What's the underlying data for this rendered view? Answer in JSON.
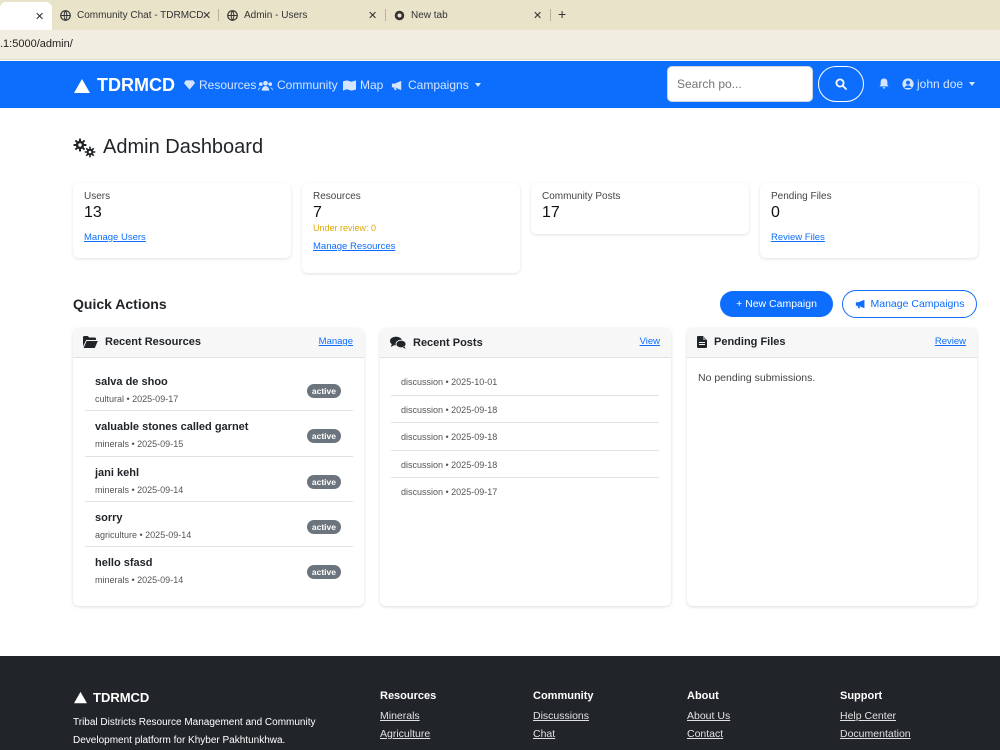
{
  "browser": {
    "tabs": [
      {
        "label": ""
      },
      {
        "label": "Community Chat - TDRMCD"
      },
      {
        "label": "Admin - Users"
      },
      {
        "label": "New tab"
      }
    ],
    "new_tab_symbol": "+",
    "close_symbol": "✕",
    "address": ".1:5000/admin/"
  },
  "navbar": {
    "brand": "TDRMCD",
    "links": [
      {
        "label": "Resources",
        "icon": "gem-icon"
      },
      {
        "label": "Community",
        "icon": "users-icon"
      },
      {
        "label": "Map",
        "icon": "map-icon"
      },
      {
        "label": "Campaigns",
        "icon": "bullhorn-icon"
      }
    ],
    "search_placeholder": "Search po...",
    "user": "john doe",
    "color": "#0d6efd"
  },
  "page": {
    "title": "Admin Dashboard"
  },
  "stats": [
    {
      "label": "Users",
      "value": "13",
      "sub": "",
      "link": "Manage Users"
    },
    {
      "label": "Resources",
      "value": "7",
      "sub": "Under review: 0",
      "link": "Manage Resources"
    },
    {
      "label": "Community Posts",
      "value": "17",
      "sub": "",
      "link": ""
    },
    {
      "label": "Pending Files",
      "value": "0",
      "sub": "",
      "link": "Review Files"
    }
  ],
  "quick_actions": {
    "title": "Quick Actions",
    "new_campaign": "+ New Campaign",
    "manage_campaigns": "Manage Campaigns"
  },
  "panels": {
    "resources": {
      "title": "Recent Resources",
      "link": "Manage",
      "items": [
        {
          "name": "salva de shoo",
          "meta": "cultural • 2025-09-17",
          "status": "active"
        },
        {
          "name": "valuable stones called garnet",
          "meta": "minerals • 2025-09-15",
          "status": "active"
        },
        {
          "name": "jani kehl",
          "meta": "minerals • 2025-09-14",
          "status": "active"
        },
        {
          "name": "sorry",
          "meta": "agriculture • 2025-09-14",
          "status": "active"
        },
        {
          "name": "hello sfasd",
          "meta": "minerals • 2025-09-14",
          "status": "active"
        }
      ]
    },
    "posts": {
      "title": "Recent Posts",
      "link": "View",
      "items": [
        "discussion • 2025-10-01",
        "discussion • 2025-09-18",
        "discussion • 2025-09-18",
        "discussion • 2025-09-18",
        "discussion • 2025-09-17"
      ]
    },
    "files": {
      "title": "Pending Files",
      "link": "Review",
      "empty": "No pending submissions."
    }
  },
  "footer": {
    "brand": "TDRMCD",
    "description": "Tribal Districts Resource Management and Community Development platform for Khyber Pakhtunkhwa.",
    "columns": [
      {
        "title": "Resources",
        "links": [
          "Minerals",
          "Agriculture"
        ]
      },
      {
        "title": "Community",
        "links": [
          "Discussions",
          "Chat"
        ]
      },
      {
        "title": "About",
        "links": [
          "About Us",
          "Contact"
        ]
      },
      {
        "title": "Support",
        "links": [
          "Help Center",
          "Documentation"
        ]
      }
    ]
  }
}
